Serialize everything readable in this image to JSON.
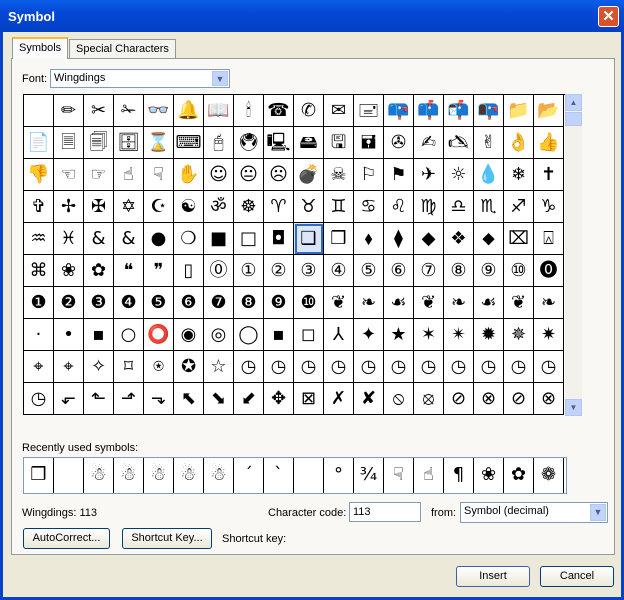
{
  "window": {
    "title": "Symbol",
    "close": "✕"
  },
  "tabs": [
    {
      "label": "Symbols",
      "active": true
    },
    {
      "label": "Special Characters",
      "active": false
    }
  ],
  "font": {
    "label": "Font:",
    "value": "Wingdings"
  },
  "grid": {
    "selected": [
      4,
      9
    ],
    "rows": [
      [
        " ",
        "✏",
        "✂",
        "✁",
        "👓",
        "🔔",
        "📖",
        "🕯",
        "☎",
        "✆",
        "✉",
        "🖃",
        "📪",
        "📫",
        "📬",
        "📭",
        "📁",
        "📂"
      ],
      [
        "📄",
        "🗏",
        "🗐",
        "🗄",
        "⌛",
        "⌨",
        "🖰",
        "🖲",
        "🖳",
        "🖴",
        "🖫",
        "🖬",
        "✇",
        "✍",
        "🖎",
        "✌",
        "👌",
        "👍"
      ],
      [
        "👎",
        "☜",
        "☞",
        "☝",
        "☟",
        "✋",
        "☺",
        "😐",
        "☹",
        "💣",
        "☠",
        "⚐",
        "⚑",
        "✈",
        "☼",
        "💧",
        "❄",
        "✝"
      ],
      [
        "✞",
        "✢",
        "✠",
        "✡",
        "☪",
        "☯",
        "ॐ",
        "☸",
        "♈",
        "♉",
        "♊",
        "♋",
        "♌",
        "♍",
        "♎",
        "♏",
        "♐",
        "♑"
      ],
      [
        "♒",
        "♓",
        "&",
        "&",
        "●",
        "❍",
        "■",
        "□",
        "◘",
        "❑",
        "❒",
        "⬧",
        "⧫",
        "◆",
        "❖",
        "⬥",
        "⌧",
        "⍓"
      ],
      [
        "⌘",
        "❀",
        "✿",
        "❝",
        "❞",
        "▯",
        "⓪",
        "①",
        "②",
        "③",
        "④",
        "⑤",
        "⑥",
        "⑦",
        "⑧",
        "⑨",
        "⑩",
        "⓿"
      ],
      [
        "❶",
        "❷",
        "❸",
        "❹",
        "❺",
        "❻",
        "❼",
        "❽",
        "❾",
        "❿",
        "❦",
        "❧",
        "☙",
        "❦",
        "❧",
        "☙",
        "❦",
        "❧"
      ],
      [
        "·",
        "•",
        "▪",
        "○",
        "⭕",
        "◉",
        "◎",
        "◯",
        "▪",
        "◻",
        "⅄",
        "✦",
        "★",
        "✶",
        "✴",
        "✹",
        "✵",
        "✷"
      ],
      [
        "⌖",
        "⌖",
        "✧",
        "⌑",
        "⍟",
        "✪",
        "☆",
        "◷",
        "◷",
        "◷",
        "◷",
        "◷",
        "◷",
        "◷",
        "◷",
        "◷",
        "◷",
        "◷"
      ],
      [
        "◷",
        "⬐",
        "⬑",
        "⬏",
        "⬎",
        "⬉",
        "⬊",
        "⬋",
        "✥",
        "⊠",
        "✗",
        "✘",
        "⦸",
        "⦻",
        "⊘",
        "⊗",
        "⊘",
        "⊗"
      ]
    ]
  },
  "recent": {
    "label": "Recently used symbols:",
    "items": [
      "❒",
      " ",
      "☃",
      "☃",
      "☃",
      "☃",
      "☃",
      "ˊ",
      "ˋ",
      " ",
      "°",
      "¾",
      "☟",
      "☝",
      "¶",
      "❀",
      "✿",
      "❁"
    ]
  },
  "status": {
    "name": "Wingdings: 113"
  },
  "char_code": {
    "label": "Character code:",
    "value": "113"
  },
  "from": {
    "label": "from:",
    "value": "Symbol (decimal)"
  },
  "buttons": {
    "autocorrect": "AutoCorrect...",
    "shortcut_key": "Shortcut Key...",
    "shortcut_label": "Shortcut key:",
    "insert": "Insert",
    "cancel": "Cancel"
  },
  "colors": {
    "title_bar": "#0548d6",
    "selection": "#316ac5",
    "dialog_bg": "#ece9d8"
  }
}
